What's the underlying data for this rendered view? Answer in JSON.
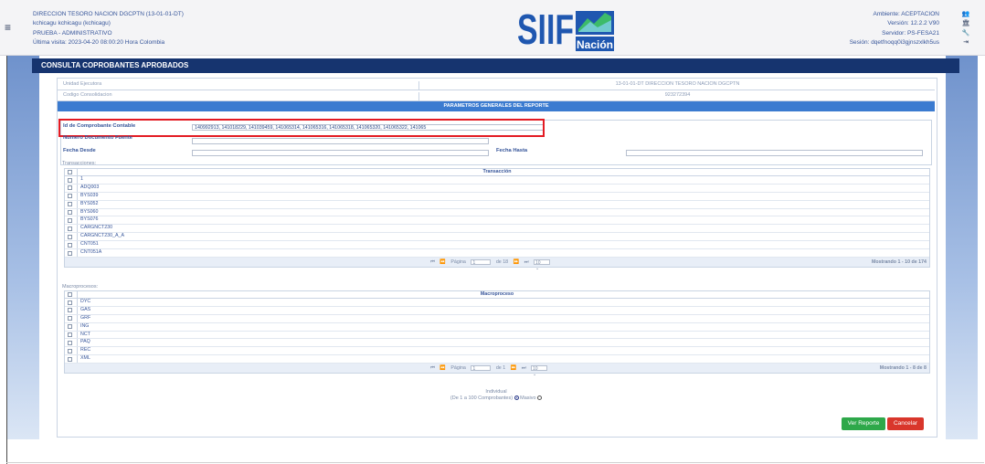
{
  "header": {
    "entity_line": "DIRECCION TESORO NACION DGCPTN (13-01-01-DT)",
    "user_line": "kchicagu kchicagu (kchicagu)",
    "profile_line": "PRUEBA - ADMINISTRATIVO",
    "last_visit_line": "Última visita: 2023-04-20 08:00:20 Hora Colombia",
    "logo_text": "SIIF",
    "logo_sub": "Nación",
    "environment_line": "Ambiente: ACEPTACION",
    "version_line": "Versión: 12.2.2 V90",
    "server_line": "Servidor: PS-FESA21",
    "session_line": "Sesión: dqetfnoqq0i3gjnszxlkh5us",
    "icons": [
      "users-icon",
      "bank-icon",
      "wrench-icon",
      "logout-icon"
    ]
  },
  "page": {
    "title": "CONSULTA COPROBANTES APROBADOS"
  },
  "info": {
    "unidad_label": "Unidad Ejecutora",
    "unidad_value": "13-01-01-DT DIRECCION TESORO NACION DGCPTN",
    "codigo_label": "Codigo Consolidacion",
    "codigo_value": "923272394"
  },
  "params": {
    "section_title": "PARAMETROS GENERALES DEL REPORTE",
    "id_label": "Id de Comprobante Contable",
    "id_value": "140992913, 141018229, 141039459, 141065314, 141065316, 141065318, 141065320, 141065322, 141065",
    "numero_label": "Numero Documento Fuente",
    "numero_value": "",
    "fecha_desde_label": "Fecha Desde",
    "fecha_desde_value": "",
    "fecha_hasta_label": "Fecha Hasta",
    "fecha_hasta_value": ""
  },
  "transacciones": {
    "section_label": "Transacciones:",
    "column": "Transacción",
    "rows": [
      "1",
      "ADQ003",
      "BYS039",
      "BYS052",
      "BYS060",
      "BYS076",
      "CARGNCT230",
      "CARGNCT230_A_A",
      "CNT051",
      "CNT051A"
    ],
    "pager": {
      "first": "⏮",
      "prev": "⏪",
      "page_label": "Página",
      "page_value": "1",
      "of_label": "de 18",
      "next": "⏩",
      "last": "⏭",
      "page_size": "10",
      "showing": "Mostrando 1 - 10 de 174"
    }
  },
  "macroprocesos": {
    "section_label": "Macroprocesos:",
    "column": "Macroproceso",
    "rows": [
      "DYC",
      "GAS",
      "GRF",
      "ING",
      "NCT",
      "PAQ",
      "REC",
      "XML"
    ],
    "pager": {
      "first": "⏮",
      "prev": "⏪",
      "page_label": "Página",
      "page_value": "1",
      "of_label": "de 1",
      "next": "⏩",
      "last": "⏭",
      "page_size": "10",
      "showing": "Mostrando 1 - 8 de 8"
    }
  },
  "report_mode": {
    "individual_label": "Individual",
    "range_label": "(De 1 a 100 Comprobantes)",
    "masivo_label": "Masivo",
    "selected": "Individual"
  },
  "actions": {
    "ver_reporte": "Ver Reporte",
    "cancelar": "Cancelar"
  },
  "colors": {
    "title_bar": "#16346f",
    "section_bar": "#3b7bd0",
    "highlight_box": "#e31b23",
    "ver_button": "#2ea84a",
    "cancel_button": "#d9362b"
  }
}
